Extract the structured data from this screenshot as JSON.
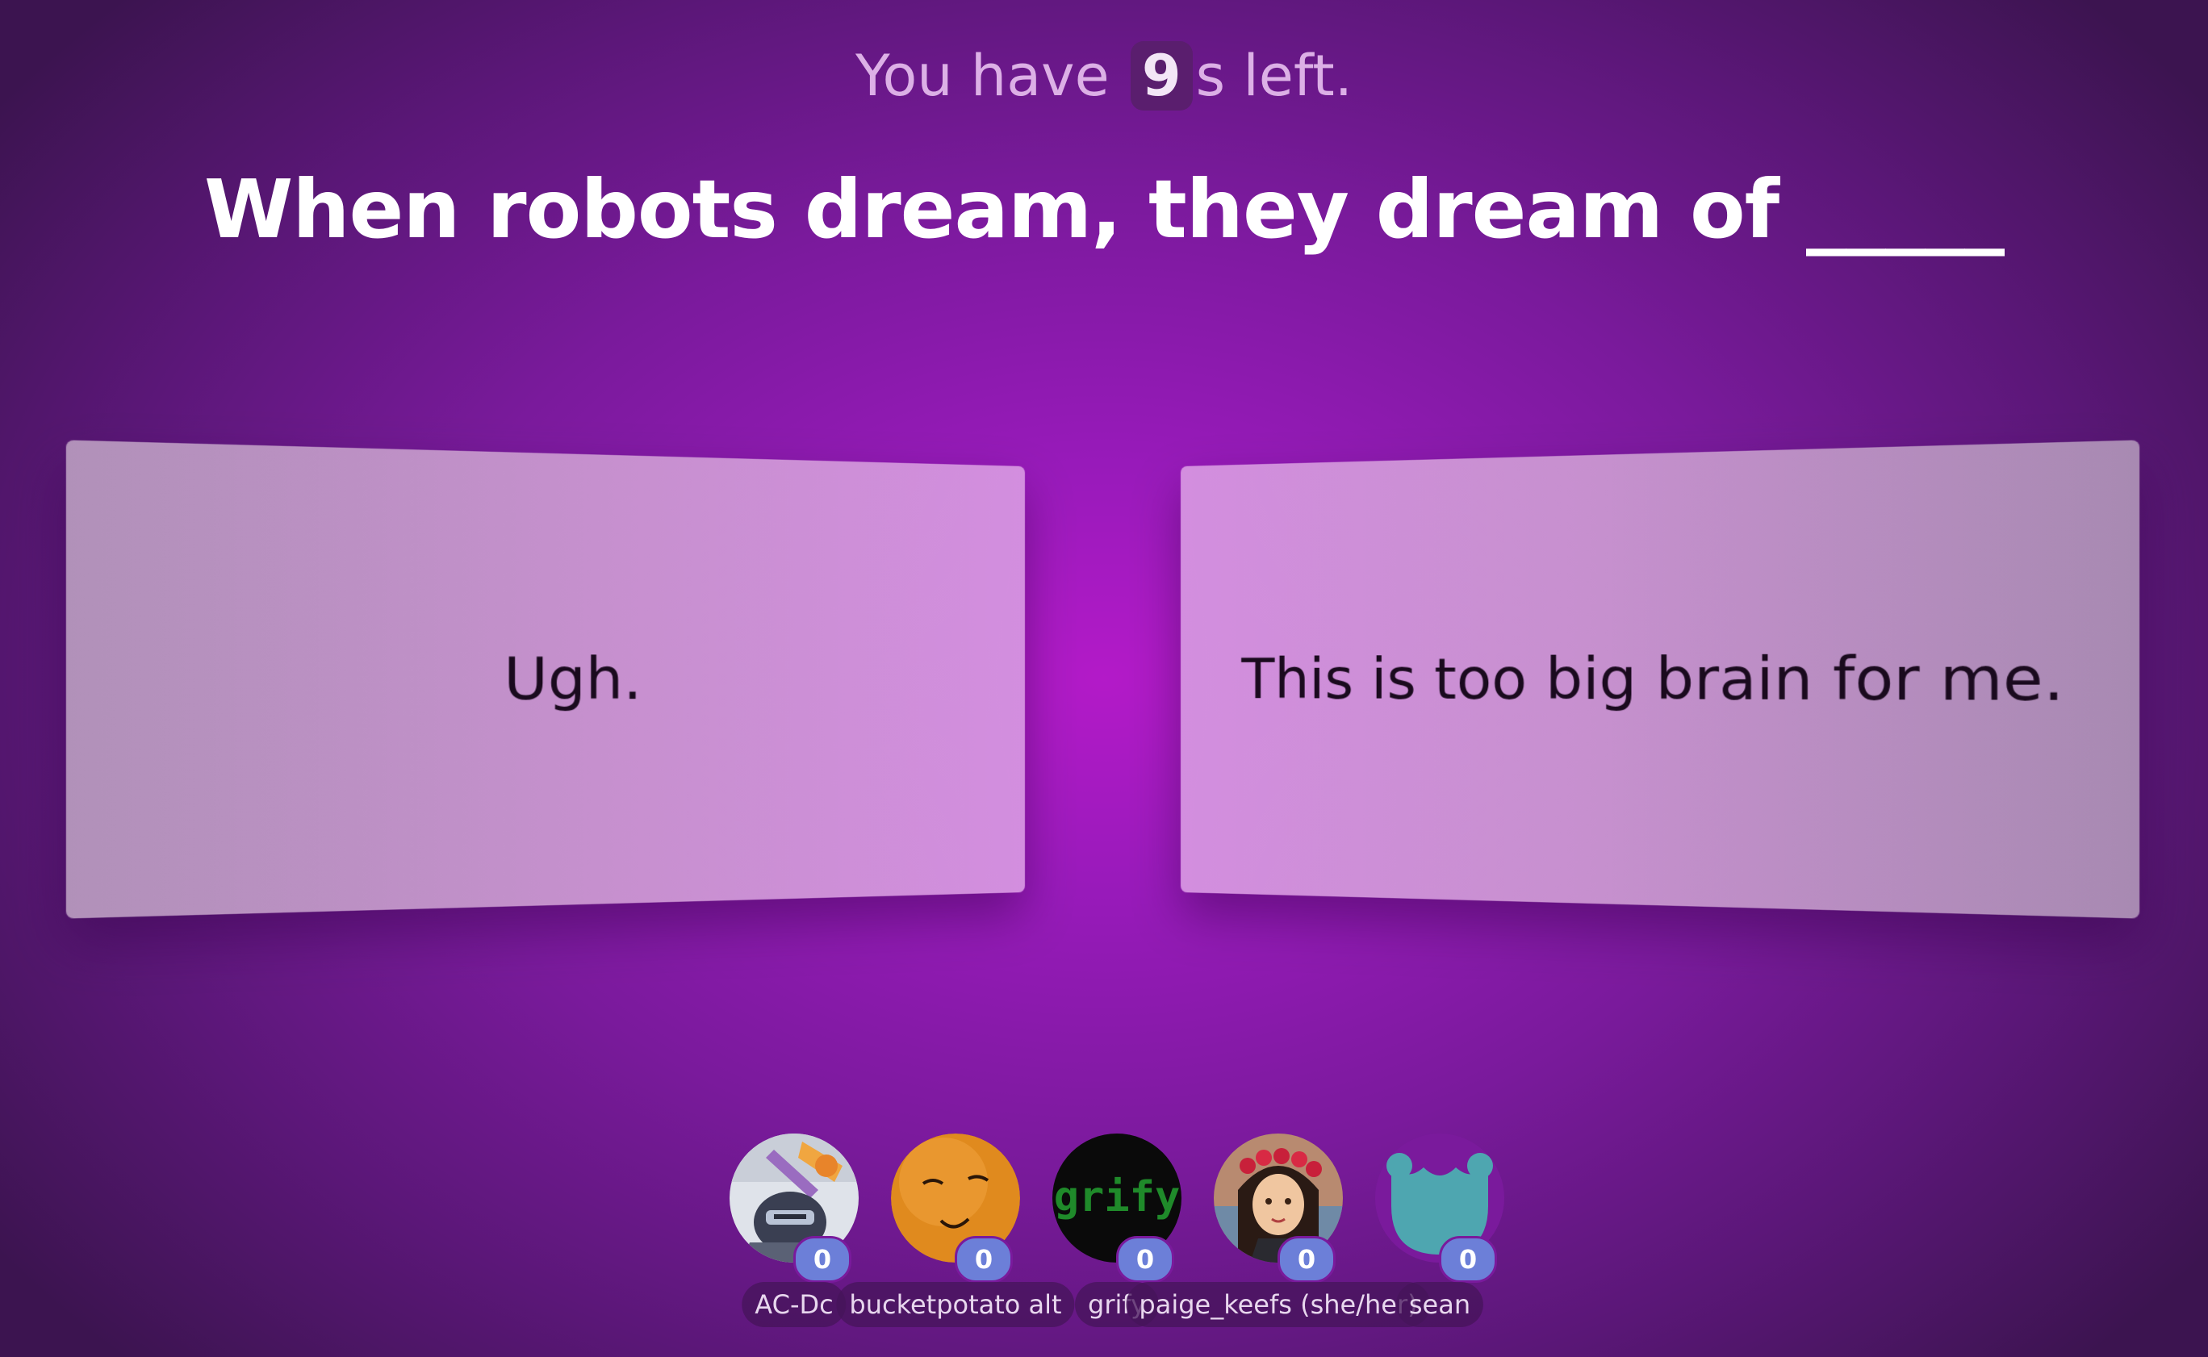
{
  "timer": {
    "prefix": "You have",
    "seconds": "9",
    "suffix": "s left."
  },
  "prompt": "When robots dream, they dream of _____",
  "answers": [
    {
      "text": "Ugh."
    },
    {
      "text": "This is too big brain for me."
    }
  ],
  "players": [
    {
      "name": "AC-Dc",
      "score": "0",
      "avatar_icon": "robot-knight-avatar-icon"
    },
    {
      "name": "bucketpotato alt",
      "score": "0",
      "avatar_icon": "orange-face-avatar-icon"
    },
    {
      "name": "grify",
      "score": "0",
      "avatar_icon": "grify-logo-avatar-icon"
    },
    {
      "name": "paige_keefs (she/her)",
      "score": "0",
      "avatar_icon": "flower-crown-girl-avatar-icon"
    },
    {
      "name": "sean",
      "score": "0",
      "avatar_icon": "teal-monster-avatar-icon"
    }
  ]
}
